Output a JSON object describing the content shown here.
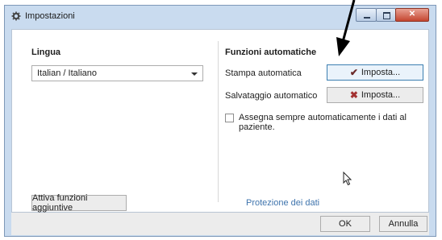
{
  "window": {
    "title": "Impostazioni",
    "icon": "gear-icon"
  },
  "window_controls": {
    "minimize_icon": "minimize-icon",
    "maximize_icon": "maximize-icon",
    "close_icon": "close-icon"
  },
  "language": {
    "heading": "Lingua",
    "selected": "Italian / Italiano"
  },
  "auto": {
    "heading": "Funzioni automatiche",
    "print_label": "Stampa automatica",
    "print_button": "Imposta...",
    "print_icon": "check-icon",
    "save_label": "Salvataggio automatico",
    "save_button": "Imposta...",
    "save_icon": "x-icon",
    "assign_label": "Assegna sempre automaticamente i dati al paziente."
  },
  "extras_button": "Attiva funzioni aggiuntive",
  "privacy_link": "Protezione dei dati",
  "footer": {
    "ok": "OK",
    "cancel": "Annulla"
  },
  "colors": {
    "accent_link": "#3f74ad",
    "check": "#6b2a2a",
    "x": "#a33131",
    "frame": "#c9dbef"
  }
}
